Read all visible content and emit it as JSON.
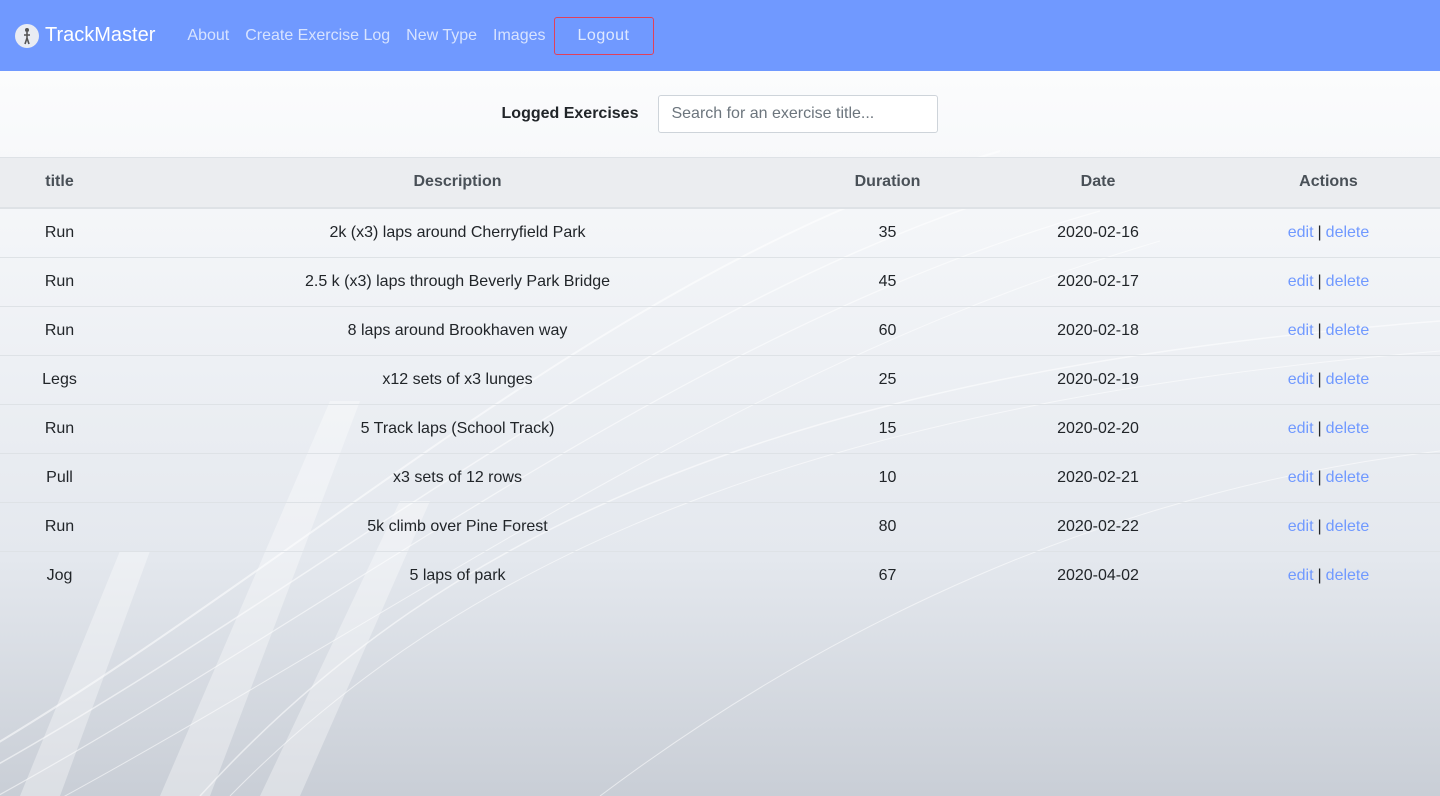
{
  "brand": {
    "name": "TrackMaster",
    "logo_icon": "runner-icon"
  },
  "nav": {
    "links": [
      "About",
      "Create Exercise Log",
      "New Type",
      "Images"
    ],
    "logout_label": "Logout"
  },
  "search": {
    "label": "Logged Exercises",
    "placeholder": "Search for an exercise title...",
    "value": ""
  },
  "table": {
    "headers": [
      "title",
      "Description",
      "Duration",
      "Date",
      "Actions"
    ],
    "rows": [
      {
        "title": "Run",
        "description": "2k (x3) laps around Cherryfield Park",
        "duration": "35",
        "date": "2020-02-16"
      },
      {
        "title": "Run",
        "description": "2.5 k (x3) laps through Beverly Park Bridge",
        "duration": "45",
        "date": "2020-02-17"
      },
      {
        "title": "Run",
        "description": "8 laps around Brookhaven way",
        "duration": "60",
        "date": "2020-02-18"
      },
      {
        "title": "Legs",
        "description": "x12 sets of x3 lunges",
        "duration": "25",
        "date": "2020-02-19"
      },
      {
        "title": "Run",
        "description": "5 Track laps (School Track)",
        "duration": "15",
        "date": "2020-02-20"
      },
      {
        "title": "Pull",
        "description": "x3 sets of 12 rows",
        "duration": "10",
        "date": "2020-02-21"
      },
      {
        "title": "Run",
        "description": "5k climb over Pine Forest",
        "duration": "80",
        "date": "2020-02-22"
      },
      {
        "title": "Jog",
        "description": "5 laps of park",
        "duration": "67",
        "date": "2020-04-02"
      }
    ],
    "actions": {
      "edit": "edit",
      "separator": "|",
      "delete": "delete"
    }
  },
  "colors": {
    "navbar": "#7099ff",
    "link": "#7099ff",
    "logout_border": "#e0405a"
  }
}
